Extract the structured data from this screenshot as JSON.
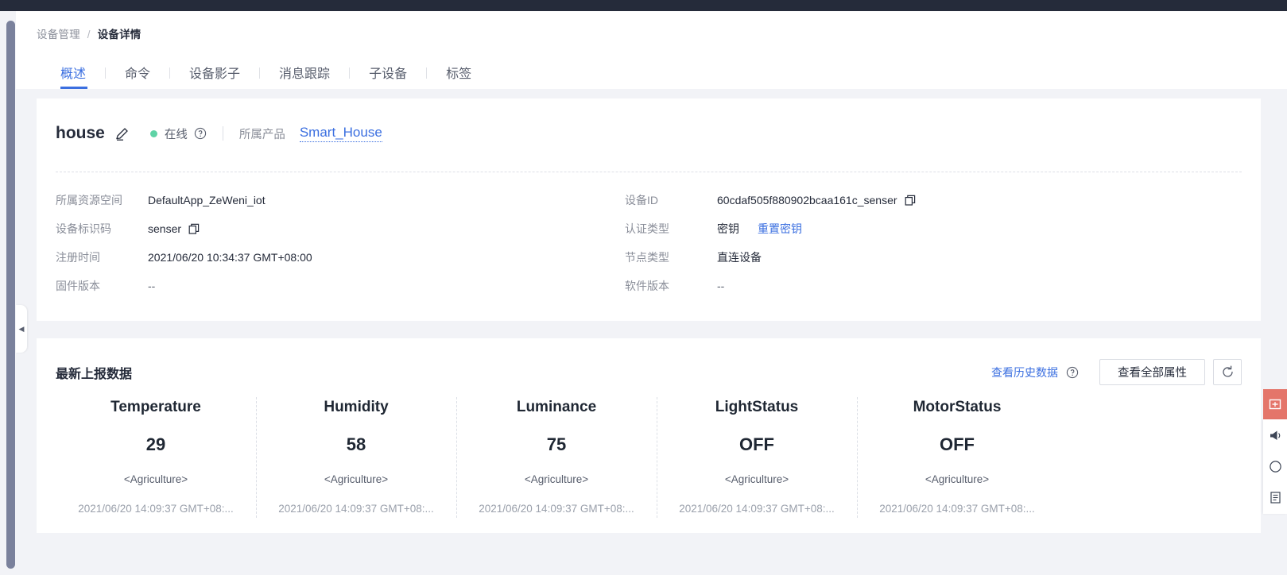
{
  "breadcrumb": {
    "parent": "设备管理",
    "separator": "/",
    "current": "设备详情"
  },
  "tabs": [
    {
      "label": "概述",
      "active": true
    },
    {
      "label": "命令",
      "active": false
    },
    {
      "label": "设备影子",
      "active": false
    },
    {
      "label": "消息跟踪",
      "active": false
    },
    {
      "label": "子设备",
      "active": false
    },
    {
      "label": "标签",
      "active": false
    }
  ],
  "device": {
    "name": "house",
    "edit_icon": "pencil-icon",
    "status_text": "在线",
    "status_color": "#5fd3a6",
    "help_icon": "question-circle-icon",
    "product_label": "所属产品",
    "product_name": "Smart_House",
    "info_left": [
      {
        "label": "所属资源空间",
        "value": "DefaultApp_ZeWeni_iot",
        "copy": false
      },
      {
        "label": "设备标识码",
        "value": "senser",
        "copy": true
      },
      {
        "label": "注册时间",
        "value": "2021/06/20 10:34:37 GMT+08:00",
        "copy": false
      },
      {
        "label": "固件版本",
        "value": "--",
        "copy": false
      }
    ],
    "info_right": [
      {
        "label": "设备ID",
        "value": "60cdaf505f880902bcaa161c_senser",
        "copy": true,
        "link": ""
      },
      {
        "label": "认证类型",
        "value": "密钥",
        "copy": false,
        "link": "重置密钥"
      },
      {
        "label": "节点类型",
        "value": "直连设备",
        "copy": false,
        "link": ""
      },
      {
        "label": "软件版本",
        "value": "--",
        "copy": false,
        "link": ""
      }
    ]
  },
  "latest_data": {
    "title": "最新上报数据",
    "history_link": "查看历史数据",
    "history_help_icon": "question-circle-icon",
    "all_props_button": "查看全部属性",
    "refresh_icon": "refresh-icon",
    "properties": [
      {
        "name": "Temperature",
        "value": "29",
        "tag": "<Agriculture>",
        "time": "2021/06/20 14:09:37 GMT+08:..."
      },
      {
        "name": "Humidity",
        "value": "58",
        "tag": "<Agriculture>",
        "time": "2021/06/20 14:09:37 GMT+08:..."
      },
      {
        "name": "Luminance",
        "value": "75",
        "tag": "<Agriculture>",
        "time": "2021/06/20 14:09:37 GMT+08:..."
      },
      {
        "name": "LightStatus",
        "value": "OFF",
        "tag": "<Agriculture>",
        "time": "2021/06/20 14:09:37 GMT+08:..."
      },
      {
        "name": "MotorStatus",
        "value": "OFF",
        "tag": "<Agriculture>",
        "time": "2021/06/20 14:09:37 GMT+08:..."
      }
    ]
  },
  "chrome": {
    "collapse_arrow": "◀",
    "right_toolbar": {
      "primary_icon": "feedback-icon",
      "primary_color": "#e4756a",
      "icons": [
        "megaphone-icon",
        "circle-icon",
        "document-icon"
      ]
    }
  },
  "theme": {
    "accent": "#3b6fe0",
    "topbar": "#252b3a",
    "page_bg": "#f2f3f7",
    "card_bg": "#ffffff"
  }
}
